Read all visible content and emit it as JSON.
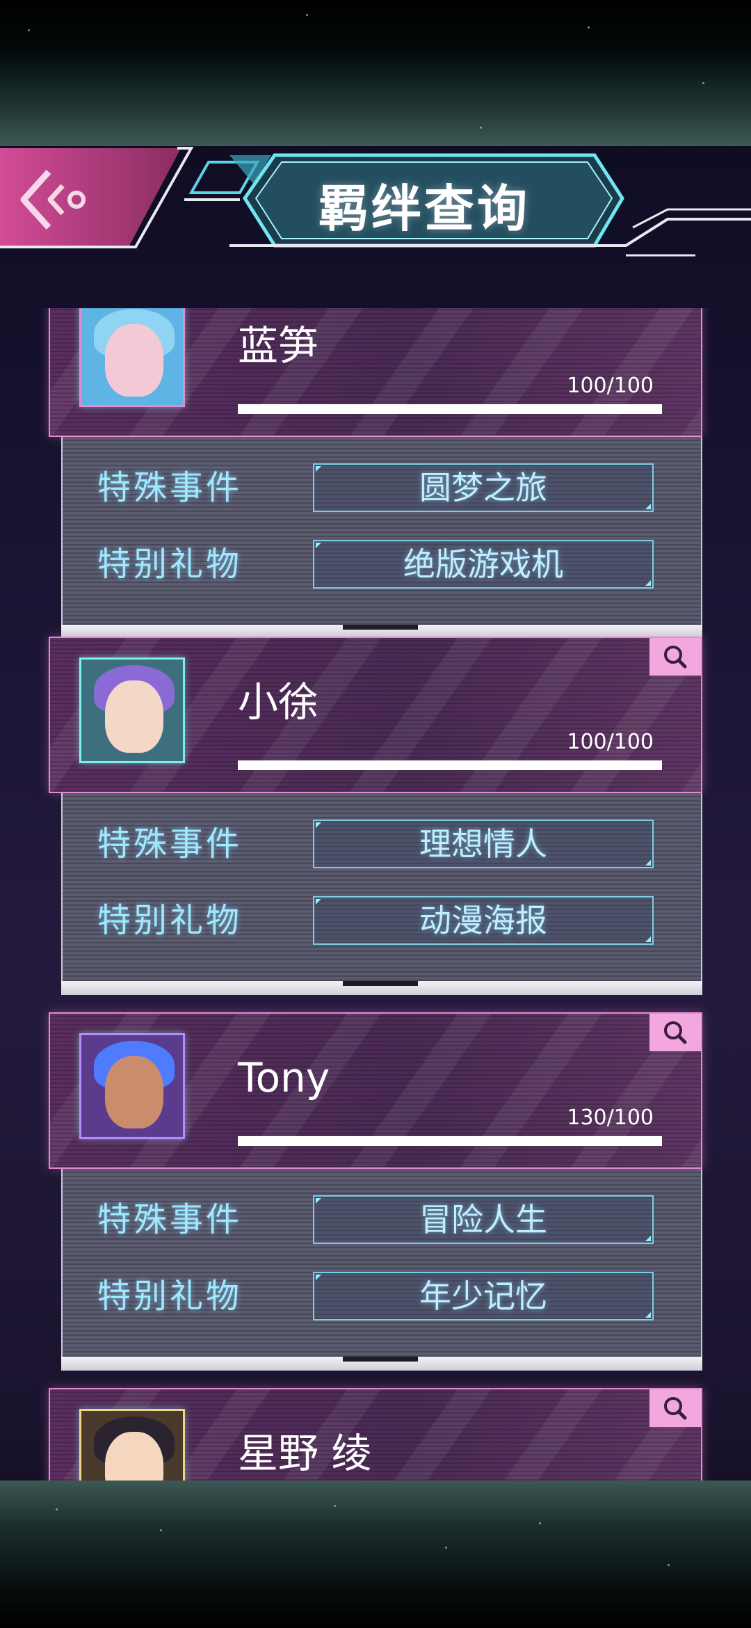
{
  "header": {
    "title": "羁绊查询"
  },
  "labels": {
    "event": "特殊事件",
    "gift": "特别礼物"
  },
  "characters": [
    {
      "name": "蓝笋",
      "score": "100/100",
      "progress": 1.0,
      "event": "圆梦之旅",
      "gift": "绝版游戏机",
      "avatar_color": "#5fb4e6",
      "hair_color": "#8fd4f2",
      "skin_color": "#f4c9d6",
      "frame_color": "#e58ad0"
    },
    {
      "name": "小徐",
      "score": "100/100",
      "progress": 1.0,
      "event": "理想情人",
      "gift": "动漫海报",
      "avatar_color": "#3d6f7e",
      "hair_color": "#8a6bd6",
      "skin_color": "#f3d7c7",
      "frame_color": "#7ff0e8"
    },
    {
      "name": "Tony",
      "score": "130/100",
      "progress": 1.0,
      "event": "冒险人生",
      "gift": "年少记忆",
      "avatar_color": "#5a3b8c",
      "hair_color": "#4f7cff",
      "skin_color": "#c98d6d",
      "frame_color": "#b58cff"
    },
    {
      "name": "星野 绫",
      "avatar_color": "#4a3a2b",
      "hair_color": "#2b2330",
      "skin_color": "#f5d6bf",
      "frame_color": "#f0d48a"
    }
  ],
  "icons": {
    "back": "back-chevron-icon",
    "search": "search-icon"
  }
}
